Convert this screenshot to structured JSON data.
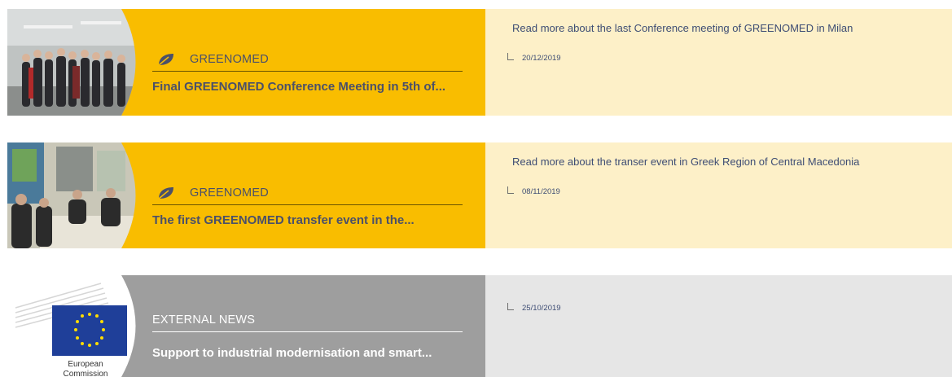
{
  "cards": [
    {
      "category": "GREENOMED",
      "headline": "Final GREENOMED Conference Meeting in 5th of...",
      "readmore": "Read more about the last Conference meeting of GREENOMED in Milan",
      "date": "20/12/2019"
    },
    {
      "category": "GREENOMED",
      "headline": "The first GREENOMED transfer event in the...",
      "readmore": "Read more about the transer event in Greek Region of Central Macedonia",
      "date": "08/11/2019"
    },
    {
      "category": "EXTERNAL NEWS",
      "headline": "Support to industrial modernisation and smart...",
      "readmore": "",
      "date": "25/10/2019",
      "logo_text": "European Commission"
    }
  ],
  "icons": {
    "category": "leaf-icon"
  },
  "colors": {
    "yellow": "#f9bd00",
    "cream": "#fdf0c8",
    "grey": "#9e9e9e",
    "lightgrey": "#e6e6e6",
    "text_dark": "#4b5069",
    "link": "#3e4d74"
  }
}
